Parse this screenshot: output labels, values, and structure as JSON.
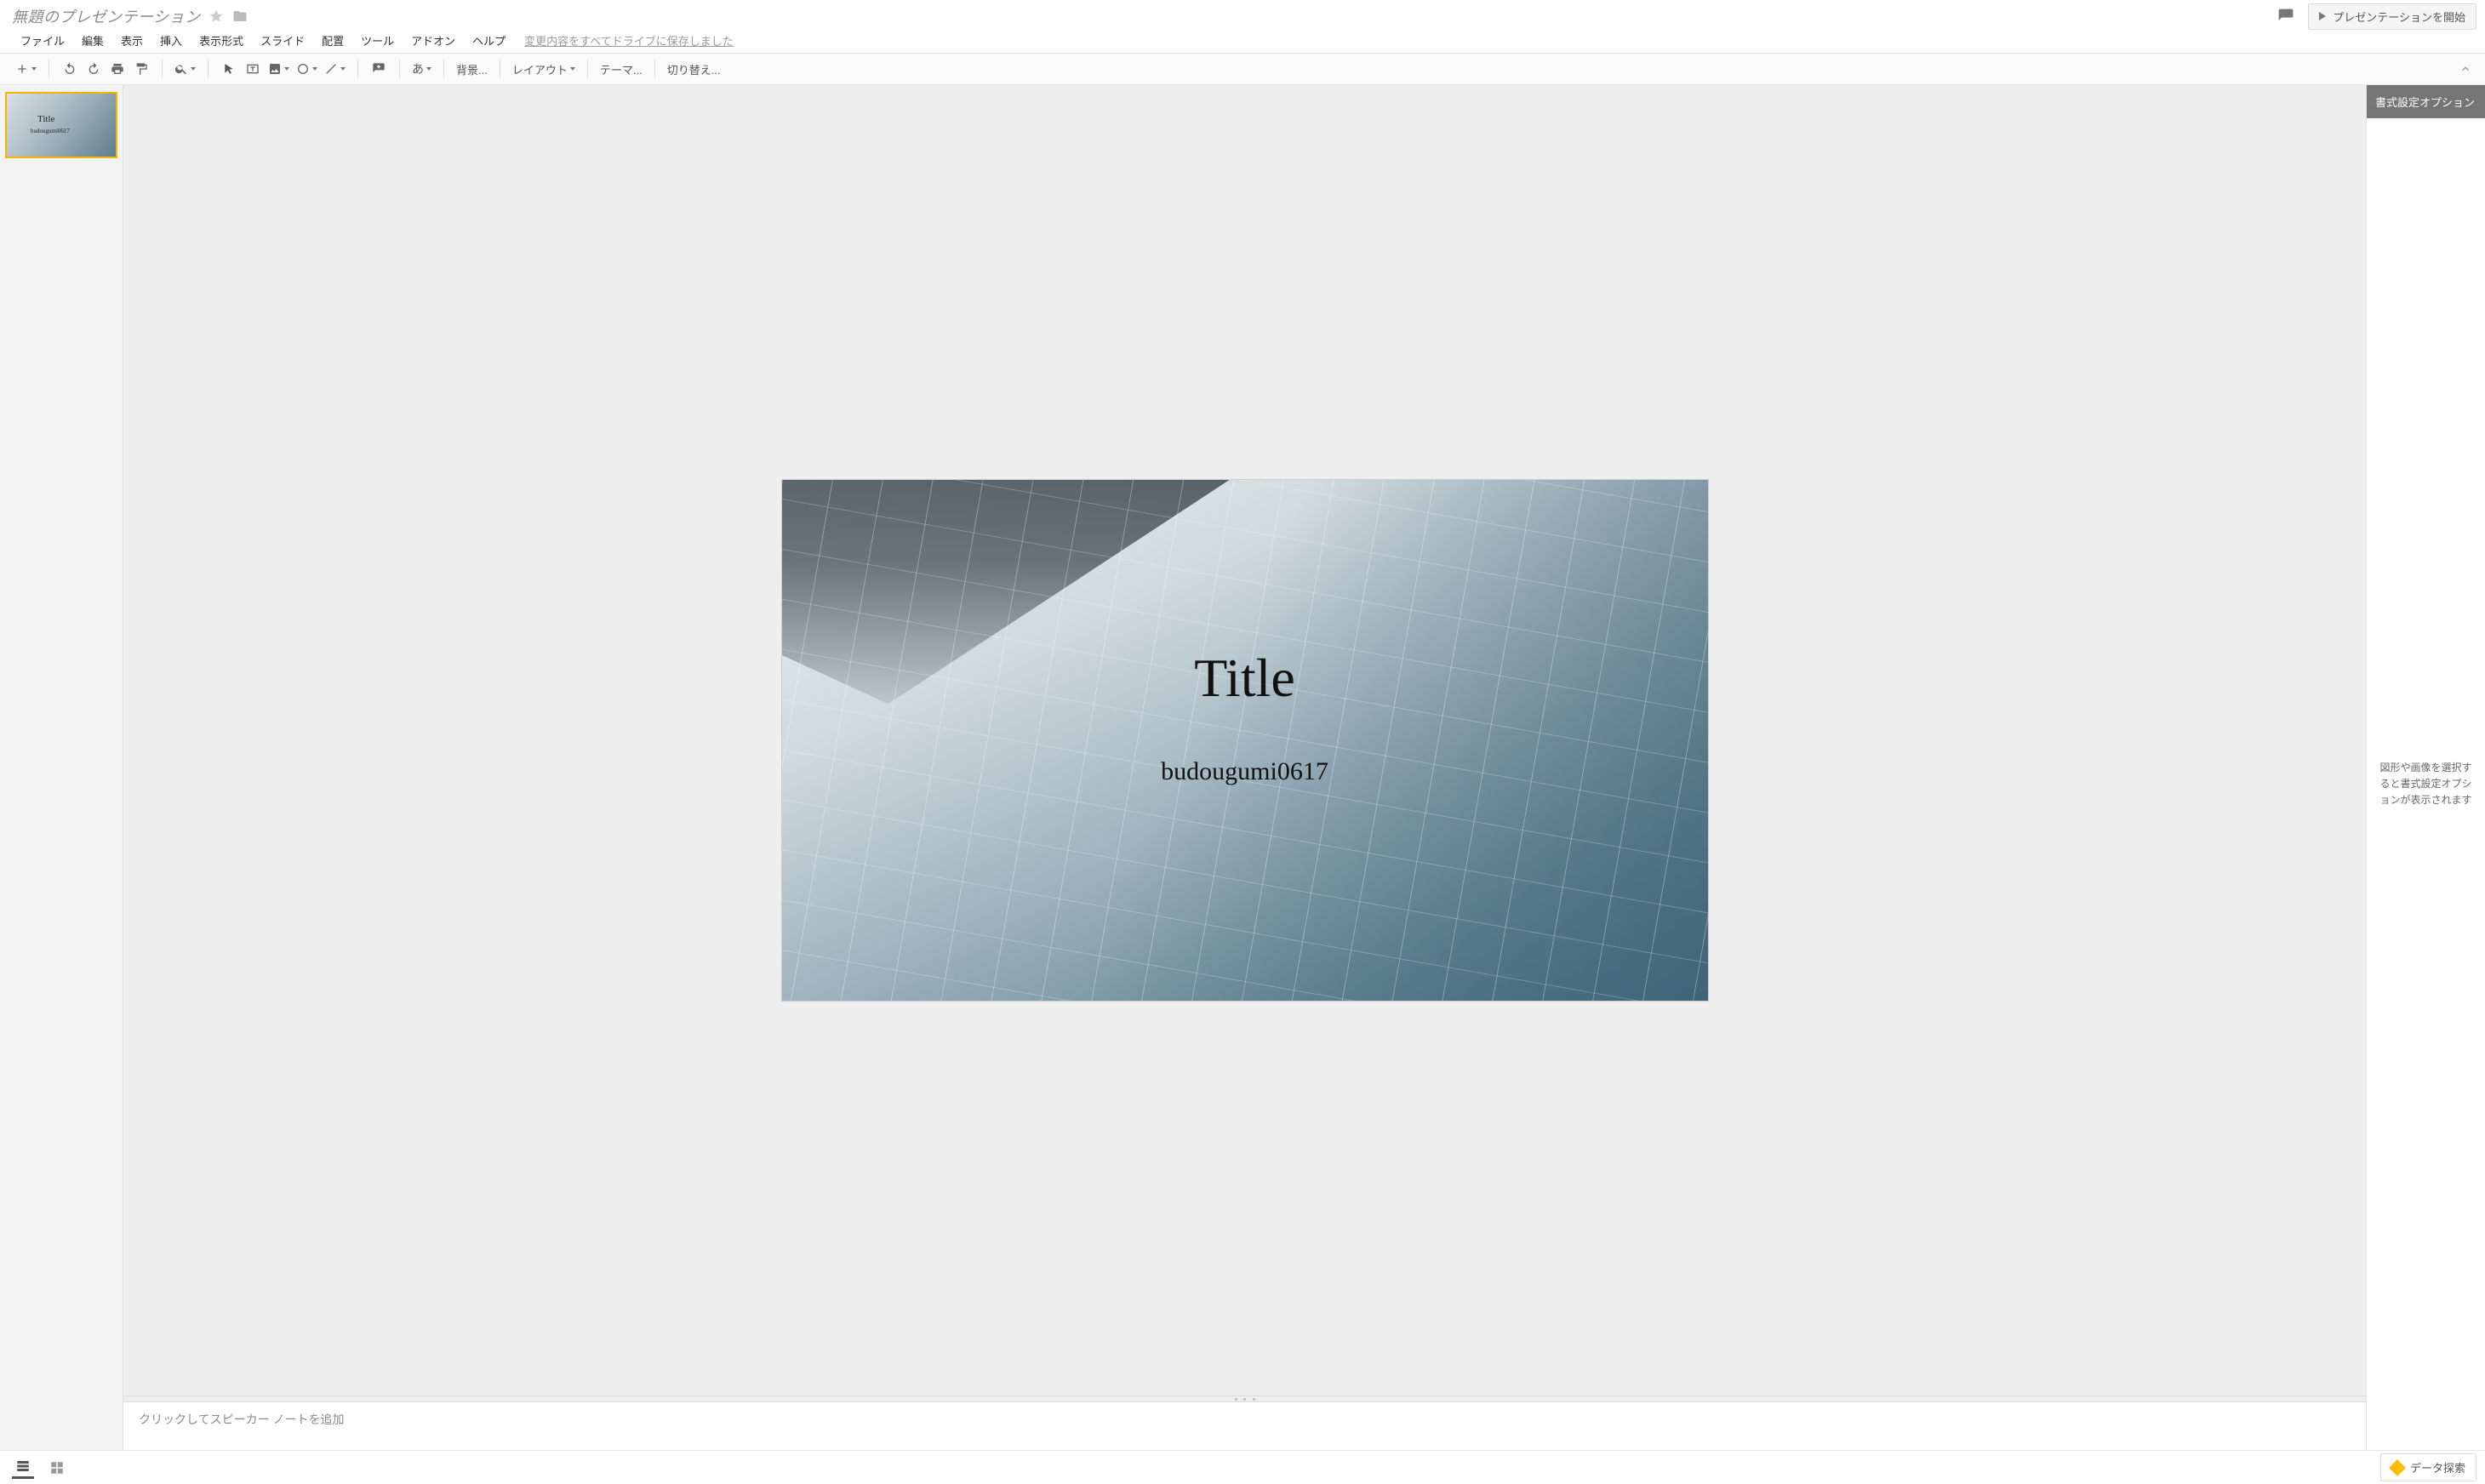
{
  "titlebar": {
    "doc_title": "無題のプレゼンテーション",
    "present_label": "プレゼンテーションを開始"
  },
  "menubar": {
    "items": [
      "ファイル",
      "編集",
      "表示",
      "挿入",
      "表示形式",
      "スライド",
      "配置",
      "ツール",
      "アドオン",
      "ヘルプ"
    ],
    "save_status": "変更内容をすべてドライブに保存しました"
  },
  "toolbar": {
    "background_label": "背景...",
    "layout_label": "レイアウト",
    "theme_label": "テーマ...",
    "transition_label": "切り替え..."
  },
  "filmstrip": {
    "slides": [
      {
        "title": "Title",
        "subtitle": "budougumi0617"
      }
    ]
  },
  "slide": {
    "title": "Title",
    "subtitle": "budougumi0617"
  },
  "notes": {
    "placeholder": "クリックしてスピーカー ノートを追加"
  },
  "rightpanel": {
    "header": "書式設定オプション",
    "body": "図形や画像を選択すると書式設定オプションが表示されます"
  },
  "footer": {
    "explore_label": "データ探索"
  }
}
